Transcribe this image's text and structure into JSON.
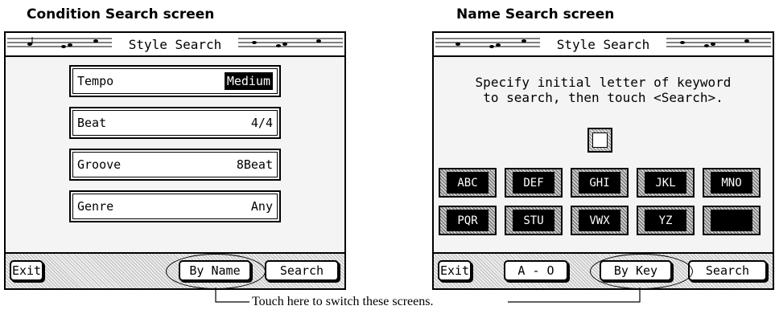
{
  "left": {
    "caption": "Condition Search screen",
    "title": "Style Search",
    "rows": [
      {
        "label": "Tempo",
        "value": "Medium",
        "highlighted": true
      },
      {
        "label": "Beat",
        "value": "4/4",
        "highlighted": false
      },
      {
        "label": "Groove",
        "value": "8Beat",
        "highlighted": false
      },
      {
        "label": "Genre",
        "value": "Any",
        "highlighted": false
      }
    ],
    "buttons": {
      "exit": "Exit",
      "by_name": "By Name",
      "search": "Search"
    }
  },
  "right": {
    "caption": "Name Search screen",
    "title": "Style Search",
    "instruction_line1": "Specify initial letter of keyword",
    "instruction_line2": "to search, then touch <Search>.",
    "letter_keys": [
      "ABC",
      "DEF",
      "GHI",
      "JKL",
      "MNO",
      "PQR",
      "STU",
      "VWX",
      "YZ",
      ""
    ],
    "buttons": {
      "exit": "Exit",
      "a_o": "A - O",
      "by_key": "By Key",
      "search": "Search"
    }
  },
  "note": "Touch here to switch these screens.",
  "icons": {
    "title_decoration": "music-staff-icon"
  }
}
